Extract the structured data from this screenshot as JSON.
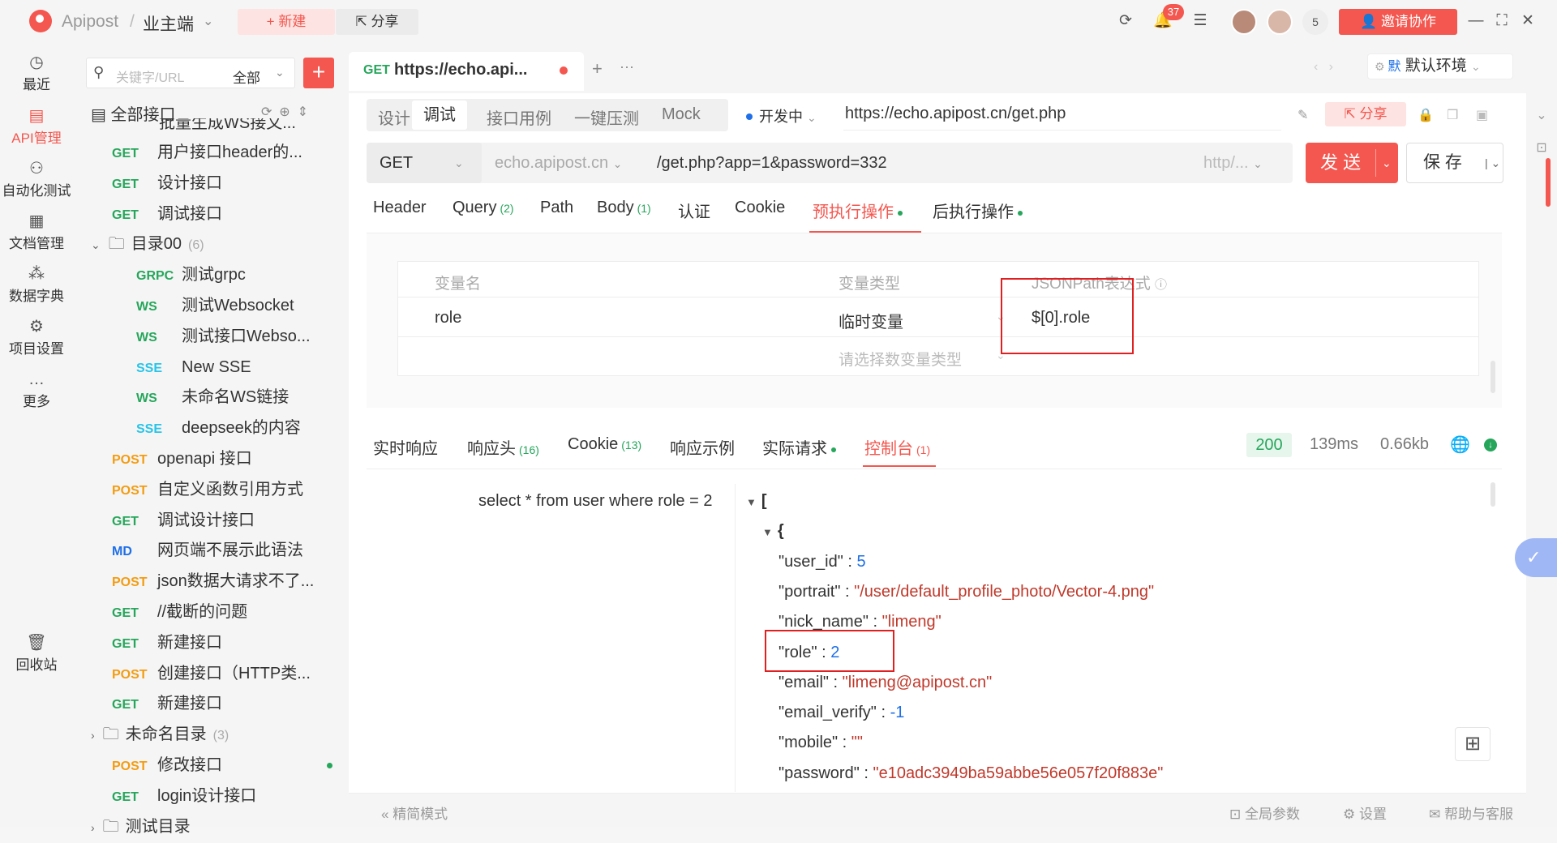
{
  "topbar": {
    "app_name": "Apipost",
    "slash": "/",
    "project": "业主端",
    "new_label": "+  新建",
    "share_label": "分享",
    "notification_count": "37",
    "member_count": "5",
    "invite_label": "邀请协作"
  },
  "nav": [
    {
      "label": "最近",
      "icon": "clock-icon",
      "glyph": "◷"
    },
    {
      "label": "API管理",
      "icon": "api-icon",
      "glyph": "▤"
    },
    {
      "label": "自动化测试",
      "icon": "automation-icon",
      "glyph": "⚇"
    },
    {
      "label": "文档管理",
      "icon": "document-icon",
      "glyph": "▦"
    },
    {
      "label": "数据字典",
      "icon": "dictionary-icon",
      "glyph": "⁂"
    },
    {
      "label": "项目设置",
      "icon": "settings-icon",
      "glyph": "⚙"
    },
    {
      "label": "更多",
      "icon": "more-icon",
      "glyph": "…"
    },
    {
      "label": "回收站",
      "icon": "trash-icon",
      "glyph": "🗑"
    }
  ],
  "tree": {
    "search_placeholder": "关键字/URL",
    "filter_value": "全部",
    "header": "全部接口",
    "partial_top": "批量生成WS接文...",
    "items": [
      {
        "method": "GET",
        "cls": "m-get",
        "label": "用户接口header的...",
        "indent": 0
      },
      {
        "method": "GET",
        "cls": "m-get",
        "label": "设计接口",
        "indent": 0
      },
      {
        "method": "GET",
        "cls": "m-get",
        "label": "调试接口",
        "indent": 0
      },
      {
        "folder": true,
        "label": "目录00",
        "count": "(6)",
        "indent": 0,
        "open": true
      },
      {
        "method": "GRPC",
        "cls": "m-grpc",
        "label": "测试grpc",
        "indent": 1
      },
      {
        "method": "WS",
        "cls": "m-ws",
        "label": "测试Websocket",
        "indent": 1
      },
      {
        "method": "WS",
        "cls": "m-ws",
        "label": "测试接口Webso...",
        "indent": 1
      },
      {
        "method": "SSE",
        "cls": "m-sse",
        "label": "New SSE",
        "indent": 1
      },
      {
        "method": "WS",
        "cls": "m-ws",
        "label": "未命名WS链接",
        "indent": 1
      },
      {
        "method": "SSE",
        "cls": "m-sse",
        "label": "deepseek的内容",
        "indent": 1
      },
      {
        "method": "POST",
        "cls": "m-post",
        "label": "openapi 接口",
        "indent": 0
      },
      {
        "method": "POST",
        "cls": "m-post",
        "label": "自定义函数引用方式",
        "indent": 0
      },
      {
        "method": "GET",
        "cls": "m-get",
        "label": "调试设计接口",
        "indent": 0
      },
      {
        "method": "MD",
        "cls": "m-md",
        "label": "网页端不展示此语法",
        "indent": 0
      },
      {
        "method": "POST",
        "cls": "m-post",
        "label": "json数据大请求不了...",
        "indent": 0
      },
      {
        "method": "GET",
        "cls": "m-get",
        "label": "//截断的问题",
        "indent": 0
      },
      {
        "method": "GET",
        "cls": "m-get",
        "label": "新建接口",
        "indent": 0
      },
      {
        "method": "POST",
        "cls": "m-post",
        "label": "创建接口（HTTP类...",
        "indent": 0
      },
      {
        "method": "GET",
        "cls": "m-get",
        "label": "新建接口",
        "indent": 0
      },
      {
        "folder": true,
        "label": "未命名目录",
        "count": "(3)",
        "indent": 0,
        "open": false
      },
      {
        "method": "POST",
        "cls": "m-post",
        "label": "修改接口",
        "indent": 0,
        "dot": true
      },
      {
        "method": "GET",
        "cls": "m-get",
        "label": "login设计接口",
        "indent": 0
      },
      {
        "folder": true,
        "label": "测试目录",
        "count": "",
        "indent": 0,
        "open": false
      }
    ]
  },
  "tab": {
    "method": "GET",
    "title": "https://echo.api..."
  },
  "env": {
    "label": "默认环境",
    "badge": "默"
  },
  "subtabs": [
    "设计",
    "调试",
    "接口用例",
    "一键压测",
    "Mock"
  ],
  "status_label": "开发中",
  "full_url": "https://echo.apipost.cn/get.php",
  "share2_label": "分享",
  "request": {
    "method": "GET",
    "host": "echo.apipost.cn",
    "path": "/get.php?app=1&password=332",
    "protocol": "http/...",
    "send_label": "发 送",
    "save_label": "保 存"
  },
  "param_tabs": [
    {
      "label": "Header"
    },
    {
      "label": "Query",
      "count": "(2)"
    },
    {
      "label": "Path"
    },
    {
      "label": "Body",
      "count": "(1)"
    },
    {
      "label": "认证"
    },
    {
      "label": "Cookie"
    },
    {
      "label": "预执行操作",
      "dot": true,
      "active": true
    },
    {
      "label": "后执行操作",
      "dot": true
    }
  ],
  "vars": {
    "col_name": "变量名",
    "col_type": "变量类型",
    "col_expr": "JSONPath表达式",
    "row_name": "role",
    "row_type": "临时变量",
    "row_expr": "$[0].role",
    "placeholder_type": "请选择数变量类型"
  },
  "resp_tabs": [
    {
      "label": "实时响应"
    },
    {
      "label": "响应头",
      "count": "(16)"
    },
    {
      "label": "Cookie",
      "count": "(13)"
    },
    {
      "label": "响应示例"
    },
    {
      "label": "实际请求",
      "dot": true
    },
    {
      "label": "控制台",
      "count": "(1)",
      "active": true
    }
  ],
  "resp_meta": {
    "status": "200",
    "time": "139ms",
    "size": "0.66kb"
  },
  "console_msg": "select * from user where role = 2",
  "json_lines": [
    {
      "text": "[",
      "indent": 0,
      "toggle": true,
      "bold": true
    },
    {
      "text": "{",
      "indent": 1,
      "toggle": true,
      "bold": true
    },
    {
      "key": "\"user_id\"",
      "val": "5",
      "type": "n",
      "indent": 2
    },
    {
      "key": "\"portrait\"",
      "val": "\"/user/default_profile_photo/Vector-4.png\"",
      "type": "s",
      "indent": 2
    },
    {
      "key": "\"nick_name\"",
      "val": "\"limeng\"",
      "type": "s",
      "indent": 2
    },
    {
      "key": "\"role\"",
      "val": "2",
      "type": "n",
      "indent": 2
    },
    {
      "key": "\"email\"",
      "val": "\"limeng@apipost.cn\"",
      "type": "s",
      "indent": 2
    },
    {
      "key": "\"email_verify\"",
      "val": "-1",
      "type": "n",
      "indent": 2
    },
    {
      "key": "\"mobile\"",
      "val": "\"\"",
      "type": "s",
      "indent": 2
    },
    {
      "key": "\"password\"",
      "val": "\"e10adc3949ba59abbe56e057f20f883e\"",
      "type": "s",
      "indent": 2
    }
  ],
  "bottom": {
    "simple_mode": "精简模式",
    "global_params": "全局参数",
    "settings": "设置",
    "help": "帮助与客服"
  }
}
